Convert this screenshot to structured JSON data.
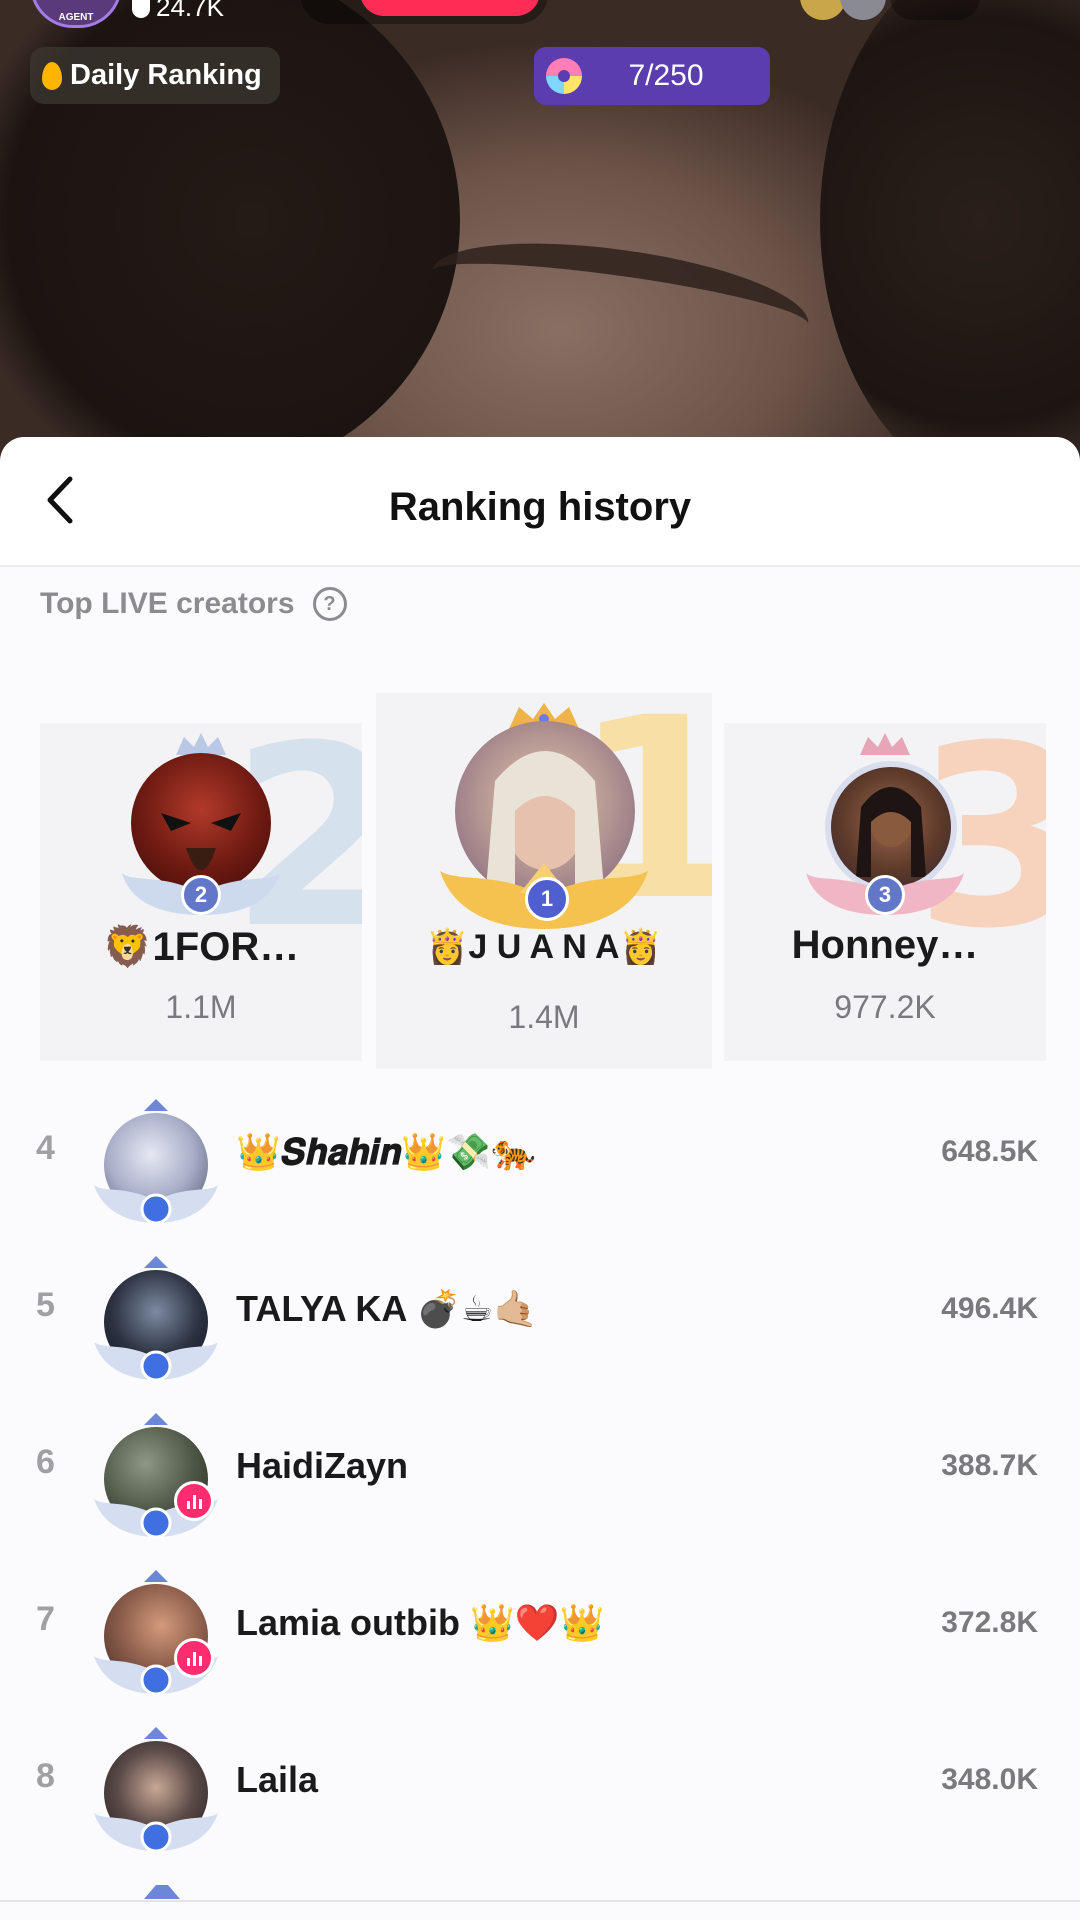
{
  "stream": {
    "host_badge": "AGENT",
    "host_likes": "24.7K",
    "daily_ranking_label": "Daily Ranking",
    "gift_progress": "7/250"
  },
  "sheet": {
    "title": "Ranking history",
    "section_label": "Top LIVE creators",
    "help_glyph": "?"
  },
  "podium": [
    {
      "rank": "2",
      "name": "🦁1FOR…",
      "score": "1.1M"
    },
    {
      "rank": "1",
      "name": "👸J U A N A👸",
      "score": "1.4M"
    },
    {
      "rank": "3",
      "name": "Honney…",
      "score": "977.2K"
    }
  ],
  "list": [
    {
      "rank": "4",
      "name": "👑𝑺𝒉𝒂𝒉𝒊𝒏👑💸🐅",
      "score": "648.5K",
      "live": false
    },
    {
      "rank": "5",
      "name": "TALYA KA 💣☕🤙🏼",
      "score": "496.4K",
      "live": false
    },
    {
      "rank": "6",
      "name": "HaidiZayn",
      "score": "388.7K",
      "live": true
    },
    {
      "rank": "7",
      "name": "Lamia outbib 👑❤️👑",
      "score": "372.8K",
      "live": true
    },
    {
      "rank": "8",
      "name": "Laila",
      "score": "348.0K",
      "live": false
    }
  ],
  "colors": {
    "gold": "#f3c76a",
    "silver_blue": "#c9d6ea",
    "bronze": "#f4c7a8",
    "live_pink": "#ff2d6f",
    "gift_purple": "#5b3db0"
  }
}
